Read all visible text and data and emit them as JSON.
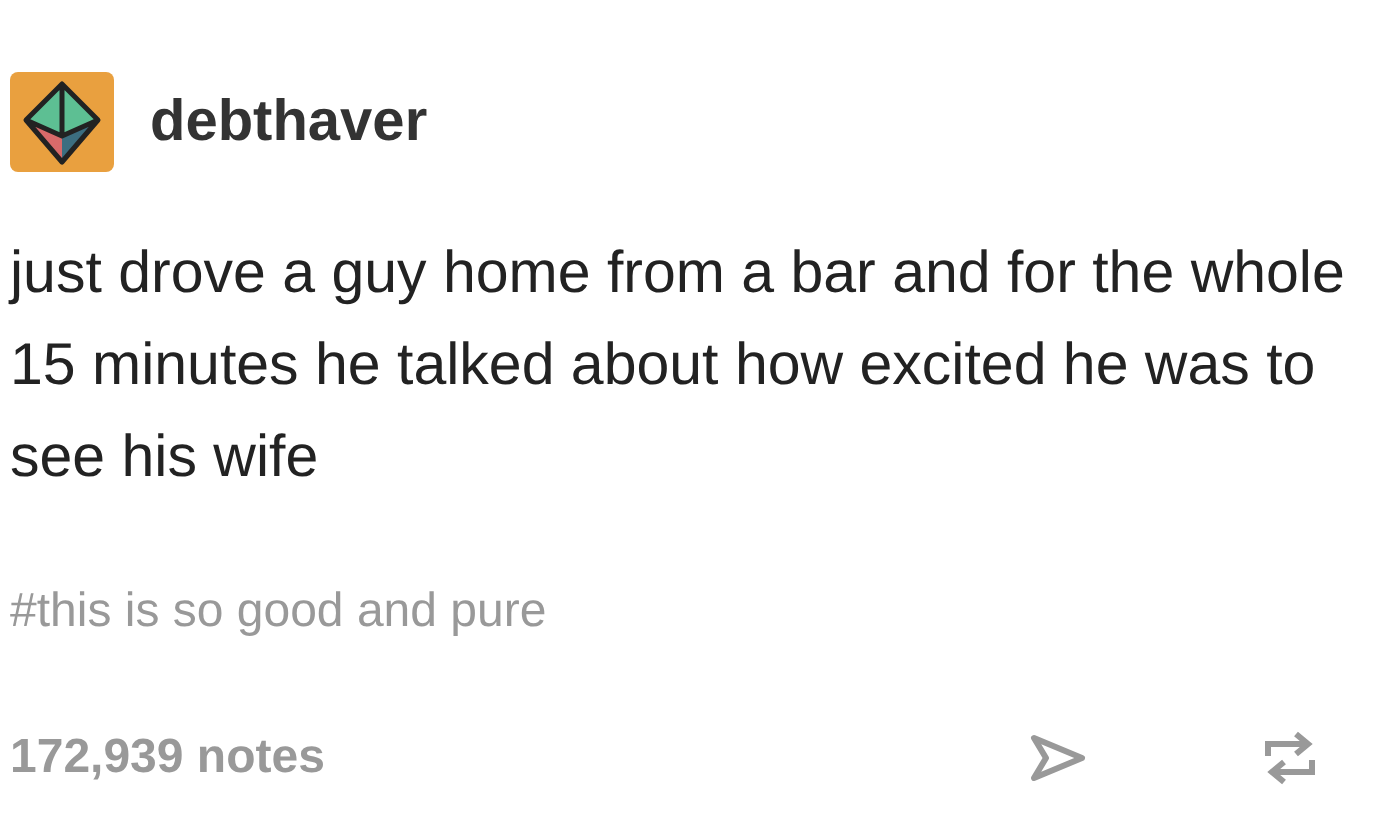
{
  "post": {
    "username": "debthaver",
    "body": "just drove a guy home from a bar and for the whole 15 minutes he talked about how excited he was to see his wife",
    "tags": [
      "#this is so good and pure"
    ],
    "notes": "172,939 notes"
  }
}
